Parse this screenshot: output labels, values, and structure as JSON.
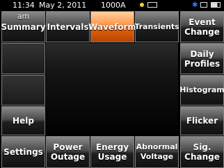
{
  "status": {
    "time": "11:34",
    "date": "May 2, 2011",
    "current": "1000A",
    "am_label": "am"
  },
  "top_tabs": [
    {
      "label": "Summary"
    },
    {
      "label": "Intervals"
    },
    {
      "label": "Waveform"
    },
    {
      "label": "Transients"
    }
  ],
  "right_menu": [
    {
      "label": "Event\nChange"
    },
    {
      "label": "Daily\nProfiles"
    },
    {
      "label": "Histogram"
    },
    {
      "label": "Flicker"
    }
  ],
  "left_menu": [
    {
      "label": "Help"
    }
  ],
  "bottom_menu": [
    {
      "label": "Settings"
    },
    {
      "label": "Power\nOutage"
    },
    {
      "label": "Energy\nUsage"
    },
    {
      "label": "Abnormal\nVoltage"
    },
    {
      "label": "Sig.\nChange"
    }
  ],
  "colors": {
    "active_tab": "#ff9a4e",
    "bluetooth_icon": "#2a7fff"
  },
  "icons": [
    "gps-fix-icon",
    "battery-icon",
    "bluetooth-icon",
    "window-icon",
    "battery-level-icon"
  ]
}
